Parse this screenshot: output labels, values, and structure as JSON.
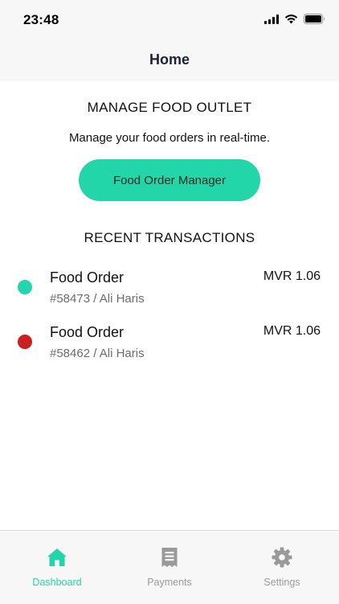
{
  "status_bar": {
    "time": "23:48"
  },
  "nav": {
    "title": "Home"
  },
  "manage": {
    "heading": "MANAGE FOOD OUTLET",
    "subtitle": "Manage your food orders in real-time.",
    "button_label": "Food Order Manager"
  },
  "transactions": {
    "heading": "RECENT TRANSACTIONS",
    "items": [
      {
        "title": "Food Order",
        "subtitle": "#58473 / Ali Haris",
        "amount": "MVR 1.06",
        "status_color": "#23d6a9"
      },
      {
        "title": "Food Order",
        "subtitle": "#58462 / Ali Haris",
        "amount": "MVR 1.06",
        "status_color": "#cc2020"
      }
    ]
  },
  "tabbar": {
    "tabs": [
      {
        "label": "Dashboard",
        "icon": "home-icon",
        "active": true
      },
      {
        "label": "Payments",
        "icon": "receipt-icon",
        "active": false
      },
      {
        "label": "Settings",
        "icon": "gear-icon",
        "active": false
      }
    ]
  },
  "colors": {
    "accent": "#23d6a9",
    "error": "#cc2020",
    "inactive": "#9a9a9a",
    "nav_title": "#1b2238"
  }
}
